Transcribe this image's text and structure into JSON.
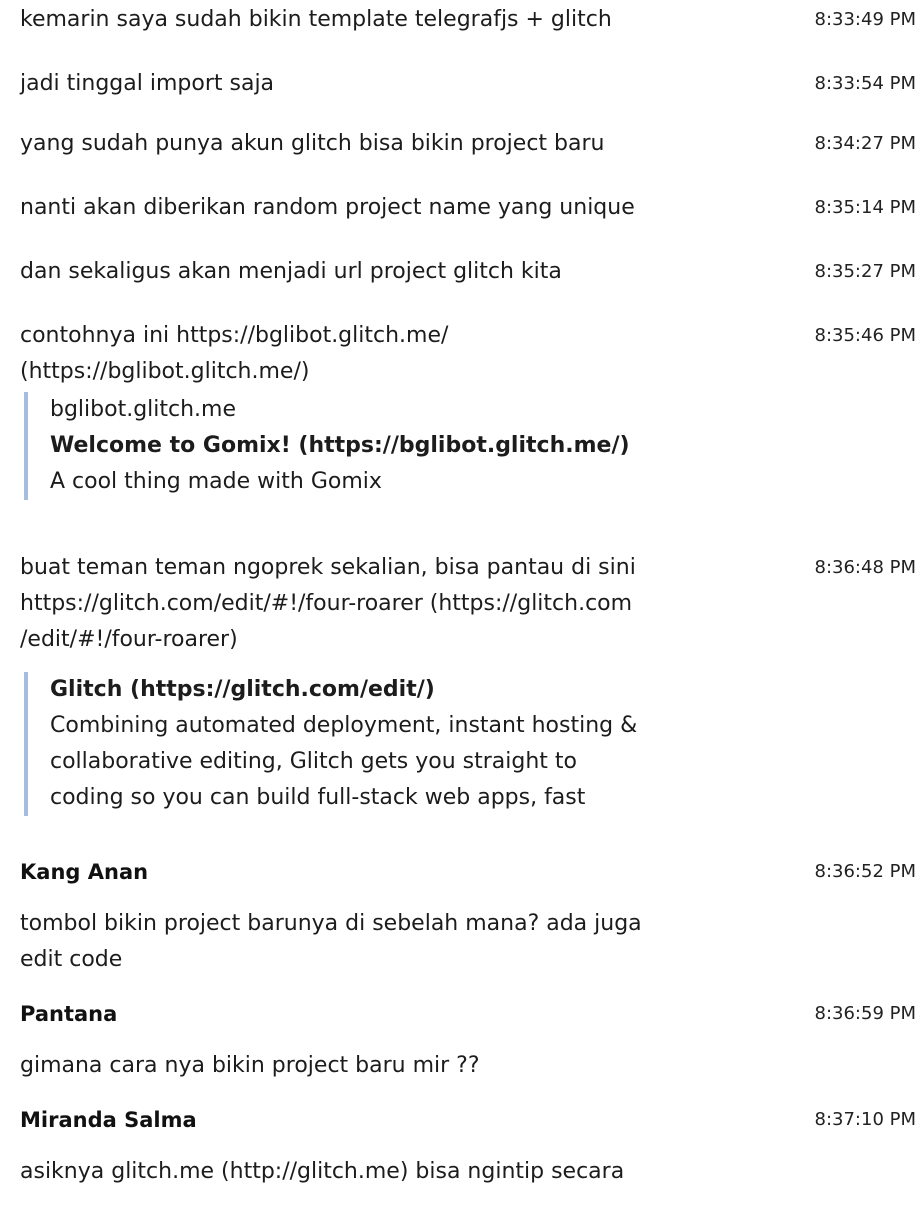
{
  "messages": [
    {
      "text": "kemarin saya sudah bikin template telegrafjs + glitch",
      "time": "8:33:49 PM"
    },
    {
      "text": "jadi tinggal import saja",
      "time": "8:33:54 PM"
    },
    {
      "text": "yang sudah punya akun glitch bisa bikin project baru",
      "time": "8:34:27 PM"
    },
    {
      "text": "nanti akan diberikan random project name yang unique",
      "time": "8:35:14 PM"
    },
    {
      "text": "dan sekaligus akan menjadi url project glitch kita",
      "time": "8:35:27 PM"
    },
    {
      "text_line1": "contohnya ini https://bglibot.glitch.me/",
      "text_line2": "(https://bglibot.glitch.me/)",
      "time": "8:35:46 PM",
      "preview": {
        "site": "bglibot.glitch.me",
        "title": "Welcome to Gomix! (https://bglibot.glitch.me/)",
        "desc": "A cool thing made with Gomix"
      }
    },
    {
      "text_line1": "buat teman teman ngoprek sekalian, bisa pantau di sini",
      "text_line2": "https://glitch.com/edit/#!/four-roarer (https://glitch.com",
      "text_line3": "/edit/#!/four-roarer)",
      "time": "8:36:48 PM",
      "preview": {
        "title": "Glitch (https://glitch.com/edit/)",
        "desc_line1": "Combining automated deployment, instant hosting &",
        "desc_line2": "collaborative editing, Glitch gets you straight to",
        "desc_line3": "coding so you can build full-stack web apps, fast"
      }
    },
    {
      "sender": "Kang Anan",
      "time": "8:36:52 PM",
      "text_line1": "tombol bikin project barunya di sebelah mana? ada juga",
      "text_line2": "edit code"
    },
    {
      "sender": "Pantana",
      "time": "8:36:59 PM",
      "text": "gimana cara nya bikin project baru mir ??"
    },
    {
      "sender": "Miranda Salma",
      "time": "8:37:10 PM",
      "text": "asiknya glitch.me (http://glitch.me) bisa ngintip secara"
    }
  ]
}
